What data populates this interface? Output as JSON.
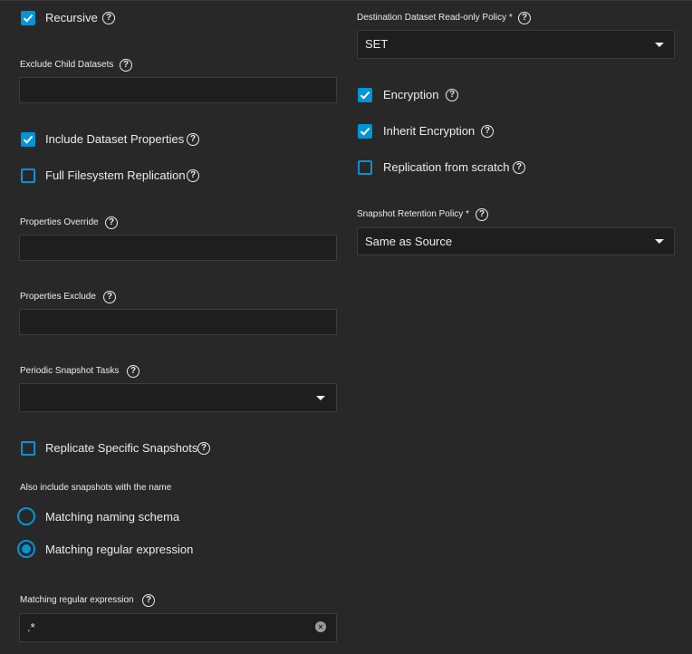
{
  "left": {
    "recursive": {
      "label": "Recursive",
      "checked": true
    },
    "exclude_child_datasets": {
      "label": "Exclude Child Datasets",
      "value": ""
    },
    "include_dataset_properties": {
      "label": "Include Dataset Properties",
      "checked": true
    },
    "full_filesystem_replication": {
      "label": "Full Filesystem Replication",
      "checked": false
    },
    "properties_override": {
      "label": "Properties Override",
      "value": ""
    },
    "properties_exclude": {
      "label": "Properties Exclude",
      "value": ""
    },
    "periodic_snapshot_tasks": {
      "label": "Periodic Snapshot Tasks",
      "value": ""
    },
    "replicate_specific_snapshots": {
      "label": "Replicate Specific Snapshots",
      "checked": false
    },
    "also_include": {
      "label": "Also include snapshots with the name",
      "options": [
        {
          "label": "Matching naming schema",
          "selected": false
        },
        {
          "label": "Matching regular expression",
          "selected": true
        }
      ]
    },
    "matching_regex": {
      "label": "Matching regular expression",
      "value": ".*"
    }
  },
  "right": {
    "readonly_policy": {
      "label": "Destination Dataset Read-only Policy",
      "required": "*",
      "value": "SET"
    },
    "encryption": {
      "label": "Encryption",
      "checked": true
    },
    "inherit_encryption": {
      "label": "Inherit Encryption",
      "checked": true
    },
    "replication_from_scratch": {
      "label": "Replication from scratch",
      "checked": false
    },
    "retention_policy": {
      "label": "Snapshot Retention Policy",
      "required": "*",
      "value": "Same as Source"
    }
  },
  "icons": {
    "help": "help-circle-icon",
    "check": "checkmark-icon",
    "caret": "caret-down-icon",
    "clear": "clear-icon"
  },
  "colors": {
    "background": "#282828",
    "accent": "#0095d5",
    "field_bg": "#1e1e1e",
    "text": "#ececec"
  }
}
